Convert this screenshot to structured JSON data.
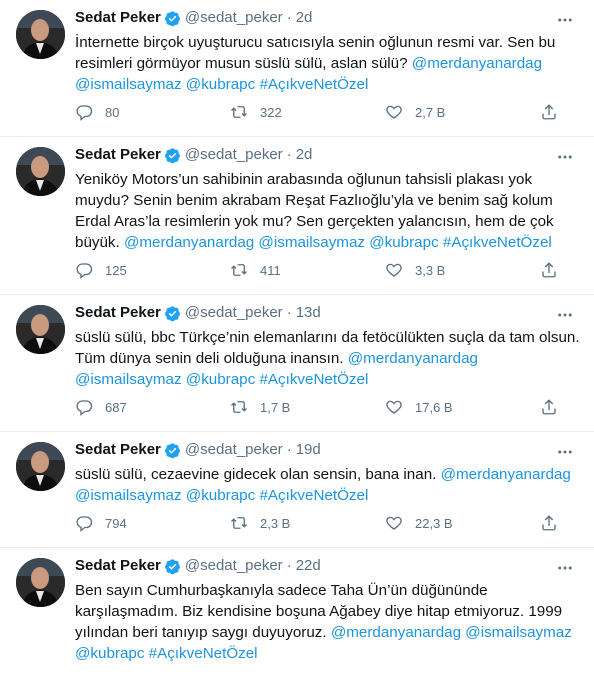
{
  "tweets": [
    {
      "name": "Sedat Peker",
      "handle": "@sedat_peker",
      "dot": "·",
      "time": "2d",
      "text": "İnternette birçok uyuşturucu satıcısıyla senin oğlunun resmi var. Sen bu resimleri görmüyor musun süslü sülü, aslan sülü? ",
      "tags": "@merdanyanardag @ismailsaymaz @kubrapc #AçıkveNetÖzel",
      "replies": "80",
      "retweets": "322",
      "likes": "2,7 B"
    },
    {
      "name": "Sedat Peker",
      "handle": "@sedat_peker",
      "dot": "·",
      "time": "2d",
      "text": "Yeniköy Motors’un sahibinin arabasında oğlunun tahsisli plakası yok muydu? Senin benim akrabam Reşat Fazlıoğlu’yla ve benim sağ kolum Erdal Aras’la resimlerin yok mu? Sen gerçekten yalancısın, hem de çok büyük. ",
      "tags": "@merdanyanardag @ismailsaymaz @kubrapc #AçıkveNetÖzel",
      "replies": "125",
      "retweets": "411",
      "likes": "3,3 B"
    },
    {
      "name": "Sedat Peker",
      "handle": "@sedat_peker",
      "dot": "·",
      "time": "13d",
      "text": "süslü sülü, bbc Türkçe’nin elemanlarını da fetöcülükten suçla da tam olsun. Tüm dünya senin deli olduğuna inansın. ",
      "tags": "@merdanyanardag @ismailsaymaz @kubrapc #AçıkveNetÖzel",
      "replies": "687",
      "retweets": "1,7 B",
      "likes": "17,6 B"
    },
    {
      "name": "Sedat Peker",
      "handle": "@sedat_peker",
      "dot": "·",
      "time": "19d",
      "text": "süslü sülü, cezaevine gidecek olan sensin, bana inan. ",
      "tags": "@merdanyanardag @ismailsaymaz @kubrapc #AçıkveNetÖzel",
      "replies": "794",
      "retweets": "2,3 B",
      "likes": "22,3 B"
    },
    {
      "name": "Sedat Peker",
      "handle": "@sedat_peker",
      "dot": "·",
      "time": "22d",
      "text": "Ben sayın Cumhurbaşkanıyla sadece Taha Ün’ün düğününde karşılaşmadım. Biz kendisine boşuna Ağabey diye hitap etmiyoruz. 1999 yılından beri tanıyıp saygı duyuyoruz. ",
      "tags": "@merdanyanardag @ismailsaymaz @kubrapc #AçıkveNetÖzel"
    }
  ],
  "icons": {
    "verified": "verified-badge-icon",
    "more": "more-options-icon",
    "reply": "reply-icon",
    "retweet": "retweet-icon",
    "like": "like-icon",
    "share": "share-icon"
  },
  "colors": {
    "accent": "#1da1f2",
    "link": "#1b95e0",
    "secondary_text": "#5b7083",
    "divider": "#e6ecf0"
  }
}
